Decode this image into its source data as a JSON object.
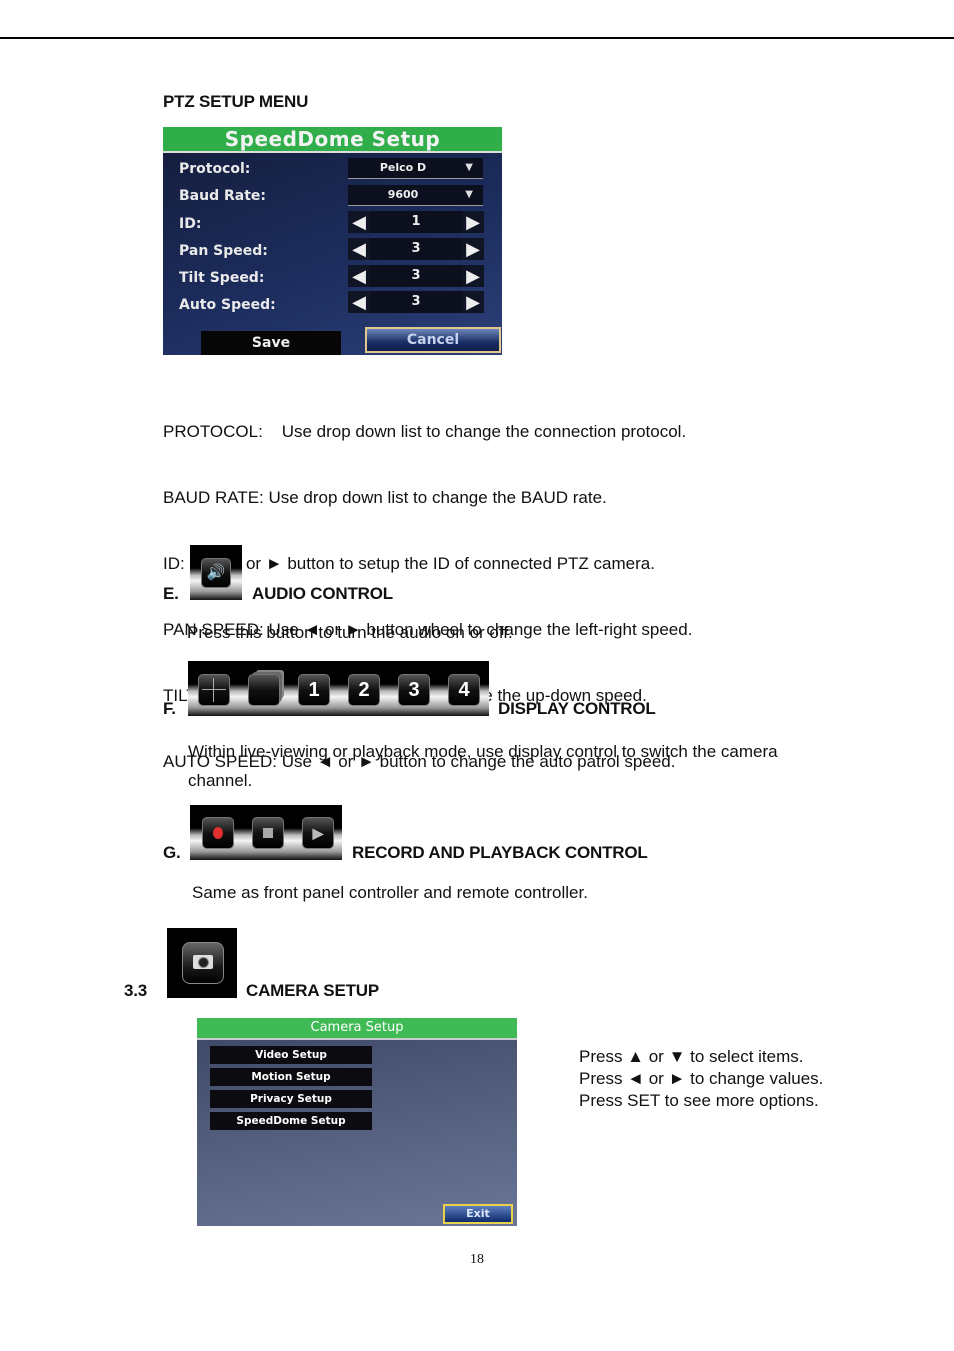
{
  "section_title": "PTZ SETUP MENU",
  "speeddome_panel": {
    "title": "SpeedDome Setup",
    "fields": [
      {
        "label": "Protocol:",
        "type": "dropdown",
        "value": "Pelco D"
      },
      {
        "label": "Baud Rate:",
        "type": "dropdown",
        "value": "9600"
      },
      {
        "label": "ID:",
        "type": "stepper",
        "value": "1"
      },
      {
        "label": "Pan Speed:",
        "type": "stepper",
        "value": "3"
      },
      {
        "label": "Tilt Speed:",
        "type": "stepper",
        "value": "3"
      },
      {
        "label": "Auto Speed:",
        "type": "stepper",
        "value": "3"
      }
    ],
    "save_label": "Save",
    "cancel_label": "Cancel",
    "dropdown_arrow": "▼",
    "left_arrow": "◀",
    "right_arrow": "▶"
  },
  "descriptions": [
    "PROTOCOL:    Use drop down list to change the connection protocol.",
    "BAUD RATE: Use drop down list to change the BAUD rate.",
    "ID: Use ◄ or ► button to setup the ID of connected PTZ camera.",
    "PAN SPEED: Use ◄ or ► button wheel to change the left-right speed.",
    "TILT SPEED: Use ◄ or ► button to change the up-down speed.",
    "AUTO SPEED: Use ◄ or ► button to change the auto patrol speed."
  ],
  "section_e": {
    "letter": "E.",
    "icon": "speaker-icon",
    "title": "AUDIO CONTROL",
    "text": "Press this button to turn the audio on or off."
  },
  "section_f": {
    "letter": "F.",
    "icons": [
      "quad-view-icon",
      "multi-view-icon",
      "channel-1",
      "channel-2",
      "channel-3",
      "channel-4"
    ],
    "channel_labels": [
      "1",
      "2",
      "3",
      "4"
    ],
    "title": "DISPLAY CONTROL",
    "text_line1": "Within live-viewing or playback mode, use display control to switch the camera",
    "text_line2": "channel."
  },
  "section_g": {
    "letter": "G.",
    "icons": [
      "record-icon",
      "stop-icon",
      "play-icon"
    ],
    "title": "RECORD AND PLAYBACK CONTROL",
    "text": "Same as front panel controller and remote controller."
  },
  "section_33": {
    "number": "3.3",
    "icon": "camera-icon",
    "title": "CAMERA SETUP"
  },
  "camera_panel": {
    "title": "Camera Setup",
    "items": [
      "Video Setup",
      "Motion Setup",
      "Privacy Setup",
      "SpeedDome Setup"
    ],
    "exit_label": "Exit"
  },
  "instructions": [
    "Press ▲ or ▼ to select items.",
    "Press ◄ or ► to change values.",
    "Press SET to see more options."
  ],
  "page_number": "18"
}
